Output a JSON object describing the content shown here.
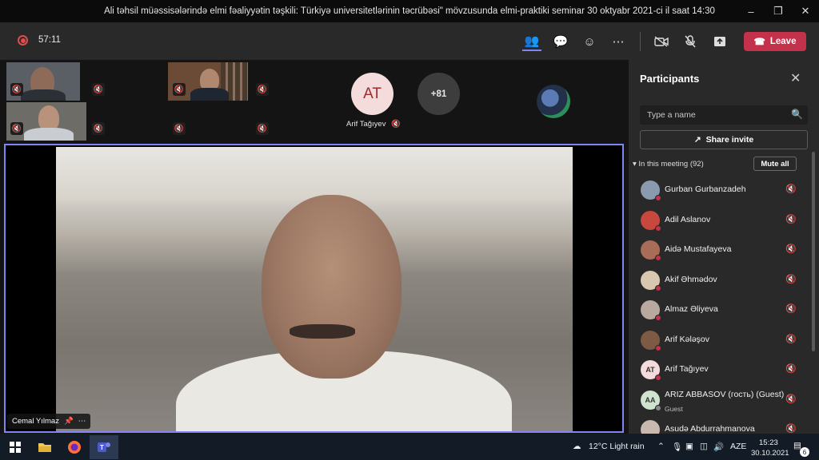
{
  "window": {
    "title": "Ali təhsil müəssisələrində elmi fəaliyyətin təşkili: Türkiyə universitetlərinin təcrübəsi\" mövzusunda elmi-praktiki seminar 30 oktyabr 2021-ci il saat 14:30"
  },
  "toolbar": {
    "timer": "57:11",
    "leave_label": "Leave"
  },
  "gallery": {
    "avatar_initials": "AT",
    "avatar_name": "Arif Tağıyev",
    "overflow_count": "+81"
  },
  "main_video": {
    "speaker_name": "Cemal Yılmaz"
  },
  "participants_panel": {
    "title": "Participants",
    "search_placeholder": "Type a name",
    "share_invite_label": "Share invite",
    "in_meeting_label": "In this meeting (92)",
    "mute_all_label": "Mute all",
    "people": [
      {
        "name": "Gurban Gurbanzadeh",
        "sub": "",
        "initials": "",
        "avatar_color": "#8a9bb0"
      },
      {
        "name": "Adil Aslanov",
        "sub": "",
        "initials": "",
        "avatar_color": "#c8483e"
      },
      {
        "name": "Aidə Mustafayeva",
        "sub": "",
        "initials": "",
        "avatar_color": "#a86d58"
      },
      {
        "name": "Akif Əhmədov",
        "sub": "",
        "initials": "",
        "avatar_color": "#d8c8b0"
      },
      {
        "name": "Almaz Əliyeva",
        "sub": "",
        "initials": "",
        "avatar_color": "#b8a8a0"
      },
      {
        "name": "Arif Kələşov",
        "sub": "",
        "initials": "",
        "avatar_color": "#7d5a44"
      },
      {
        "name": "Arif Tağıyev",
        "sub": "",
        "initials": "AT",
        "avatar_color": "#f4dcdc"
      },
      {
        "name": "ARIZ ABBASOV (гость) (Guest)",
        "sub": "Guest",
        "initials": "AA",
        "avatar_color": "#cfe3cf"
      },
      {
        "name": "Asudə Abdurrahmanova",
        "sub": "",
        "initials": "",
        "avatar_color": "#c9b8b0"
      }
    ]
  },
  "taskbar": {
    "weather": "12°C  Light rain",
    "language": "AZE",
    "time": "15:23",
    "date": "30.10.2021",
    "notification_count": "6"
  }
}
